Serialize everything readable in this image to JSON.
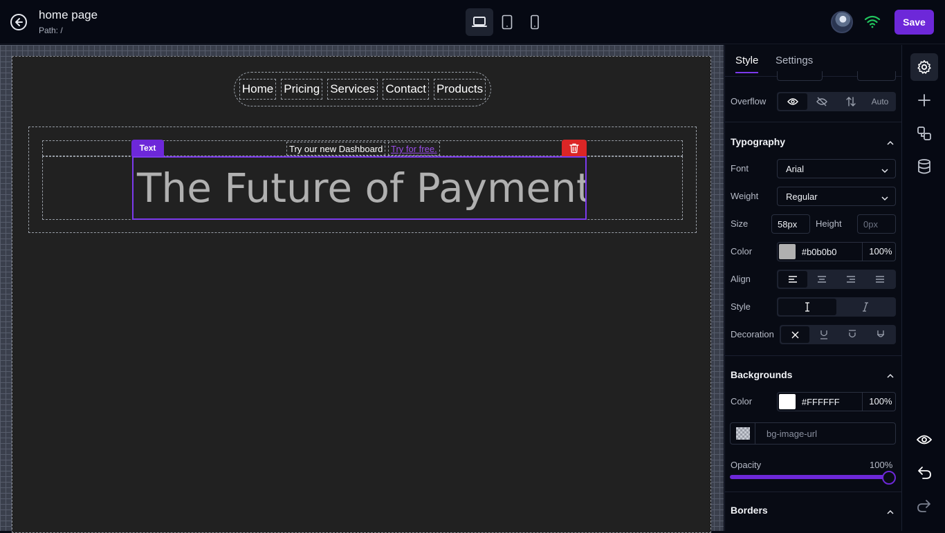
{
  "header": {
    "title": "home page",
    "path": "Path: /",
    "save_label": "Save",
    "devices": [
      "laptop-icon",
      "tablet-icon",
      "phone-icon"
    ],
    "active_device": "laptop"
  },
  "canvas": {
    "nav": [
      "Home",
      "Pricing",
      "Services",
      "Contact",
      "Products"
    ],
    "announcement": "Try our new Dashboard",
    "announcement_link": "Try for free.",
    "headline": "The Future of Payments",
    "selected_tag": "Text"
  },
  "panel": {
    "tabs": [
      "Style",
      "Settings"
    ],
    "active_tab": "Style",
    "overflow": {
      "label": "Overflow",
      "options": [
        "eye-icon",
        "eye-off-icon",
        "arrows-vertical-icon",
        "Auto"
      ],
      "auto_label": "Auto"
    },
    "typography": {
      "title": "Typography",
      "font_label": "Font",
      "font_value": "Arial",
      "weight_label": "Weight",
      "weight_value": "Regular",
      "size_label": "Size",
      "size_value": "58px",
      "height_label": "Height",
      "height_placeholder": "0px",
      "color_label": "Color",
      "color_value": "#b0b0b0",
      "color_opacity": "100%",
      "align_label": "Align",
      "style_label": "Style",
      "decoration_label": "Decoration"
    },
    "backgrounds": {
      "title": "Backgrounds",
      "color_label": "Color",
      "color_value": "#FFFFFF",
      "color_opacity": "100%",
      "image_placeholder": "bg-image-url",
      "opacity_label": "Opacity",
      "opacity_value": "100%"
    },
    "borders": {
      "title": "Borders"
    }
  },
  "colors": {
    "accent": "#6d28d9",
    "delete": "#dc2626",
    "text_color_swatch": "#b0b0b0",
    "bg_color_swatch": "#FFFFFF"
  }
}
